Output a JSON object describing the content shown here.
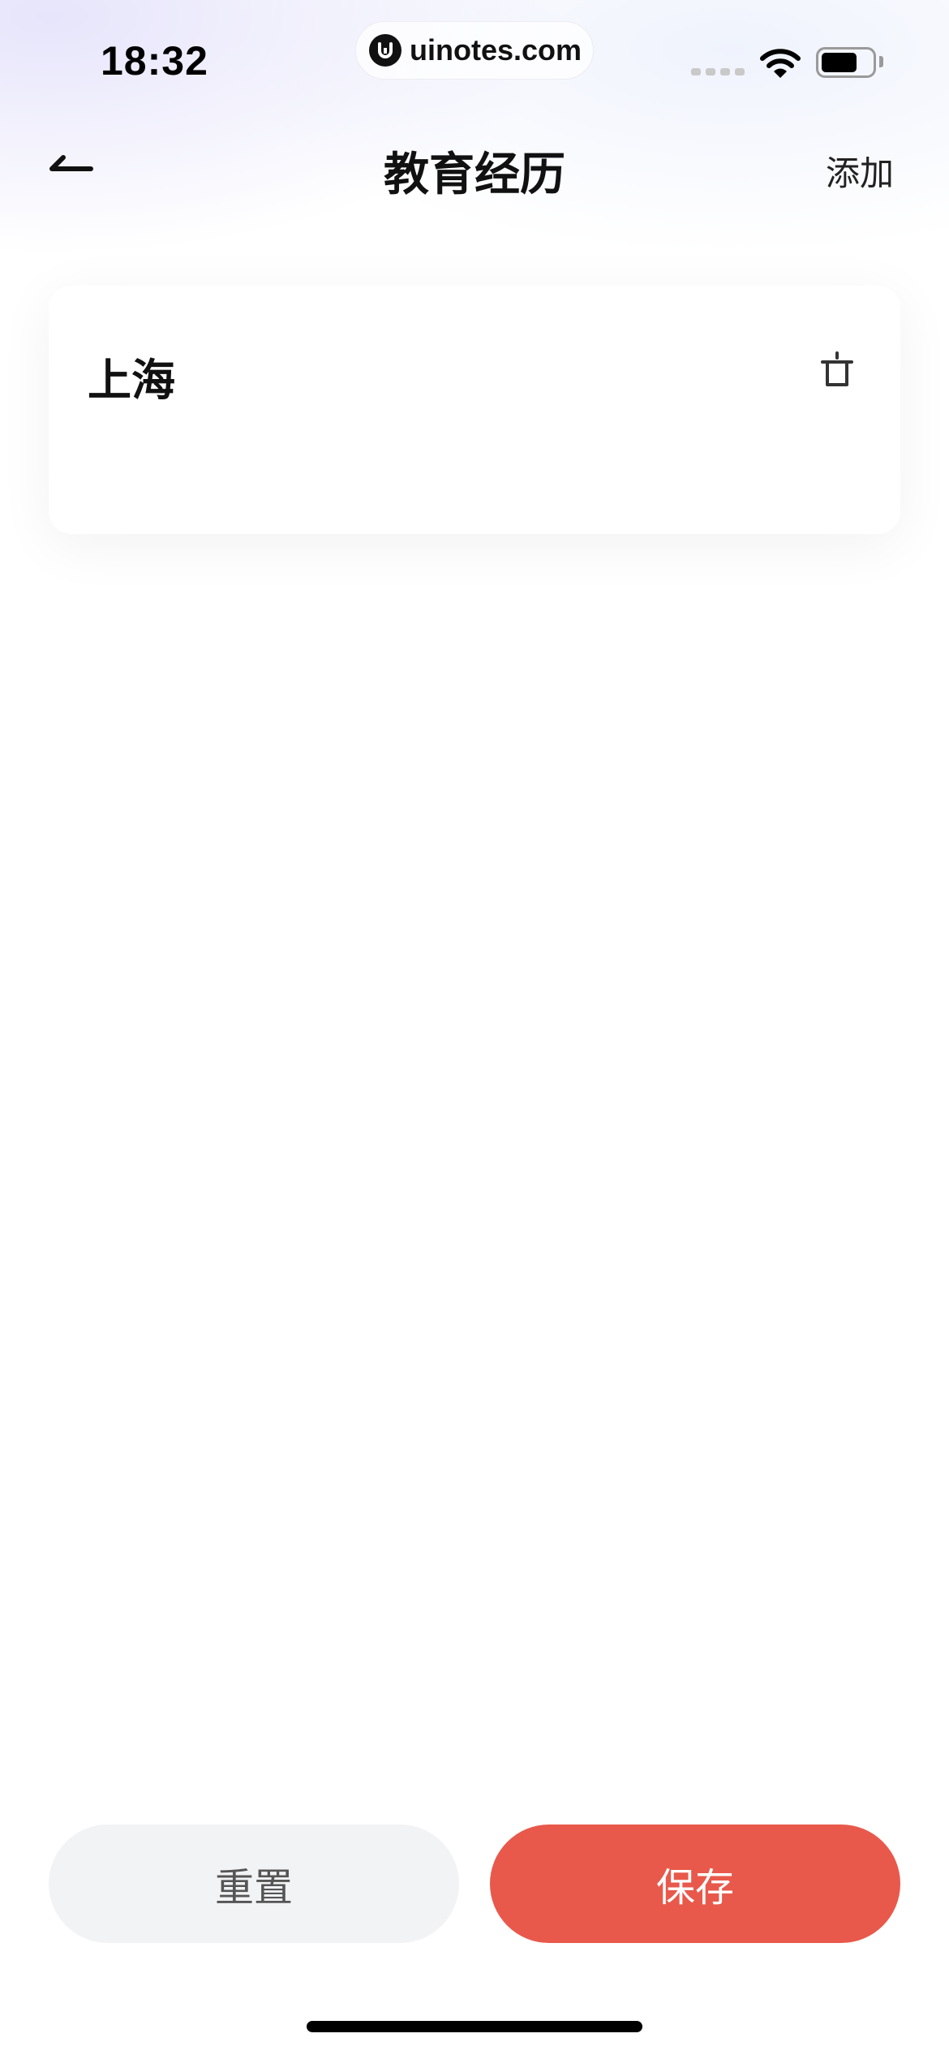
{
  "status_bar": {
    "time": "18:32",
    "url": "uinotes.com",
    "icons": [
      "signal-icon",
      "wifi-icon",
      "battery-icon"
    ]
  },
  "nav": {
    "back_icon": "arrow-left-icon",
    "title": "教育经历",
    "add_label": "添加"
  },
  "entries": [
    {
      "name": "上海",
      "delete_icon": "trash-icon"
    }
  ],
  "actions": {
    "reset_label": "重置",
    "save_label": "保存"
  },
  "colors": {
    "accent": "#e8594b",
    "secondary_button": "#f2f3f5",
    "text_primary": "#111111"
  }
}
